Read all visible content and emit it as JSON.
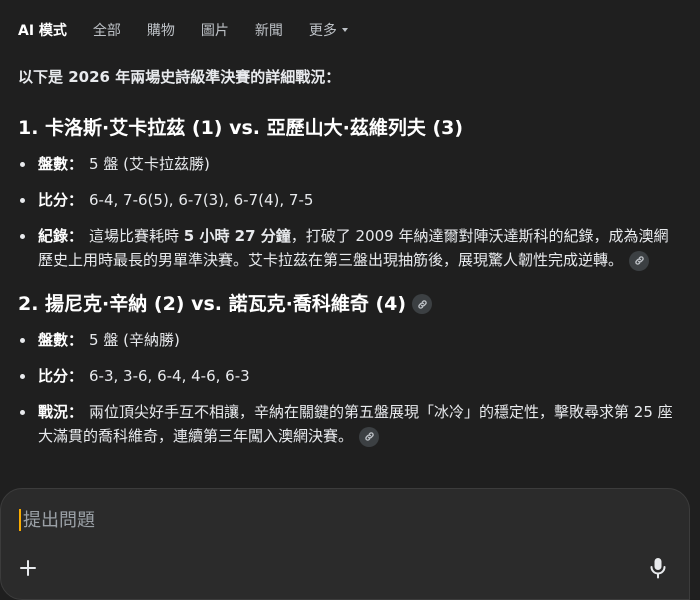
{
  "nav": {
    "tabs": [
      {
        "label": "AI 模式",
        "active": true
      },
      {
        "label": "全部"
      },
      {
        "label": "購物"
      },
      {
        "label": "圖片"
      },
      {
        "label": "新聞"
      },
      {
        "label": "更多"
      }
    ]
  },
  "intro": "以下是 2026 年兩場史詩級準決賽的詳細戰況：",
  "matches": [
    {
      "title": "1. 卡洛斯·艾卡拉茲 (1) vs. 亞歷山大·茲維列夫 (3)",
      "items": [
        {
          "label": "盤數：",
          "text": "5 盤 (艾卡拉茲勝)"
        },
        {
          "label": "比分：",
          "text": "6-4, 7-6(5), 6-7(3), 6-7(4), 7-5"
        },
        {
          "label": "紀錄：",
          "text_a": "這場比賽耗時 ",
          "text_bold": "5 小時 27 分鐘",
          "text_b": "，打破了 2009 年納達爾對陣沃達斯科的紀錄，成為澳網歷史上用時最長的男單準決賽。艾卡拉茲在第三盤出現抽筋後，展現驚人韌性完成逆轉。"
        }
      ]
    },
    {
      "title": "2. 揚尼克·辛納 (2) vs. 諾瓦克·喬科維奇 (4)",
      "items": [
        {
          "label": "盤數：",
          "text": "5 盤 (辛納勝)"
        },
        {
          "label": "比分：",
          "text": "6-3, 3-6, 6-4, 4-6, 6-3"
        },
        {
          "label": "戰況：",
          "text": "兩位頂尖好手互不相讓，辛納在關鍵的第五盤展現「冰冷」的穩定性，擊敗尋求第 25 座大滿貫的喬科維奇，連續第三年闖入澳網決賽。"
        }
      ]
    }
  ],
  "composer": {
    "placeholder": "提出問題",
    "value": ""
  },
  "icons": {
    "link": "link-icon",
    "plus": "plus-icon",
    "mic": "microphone-icon",
    "caret": "chevron-down-icon"
  },
  "colors": {
    "background": "#1f1f1f",
    "panel": "#2b2b2b",
    "cursor": "#f9ab00"
  }
}
